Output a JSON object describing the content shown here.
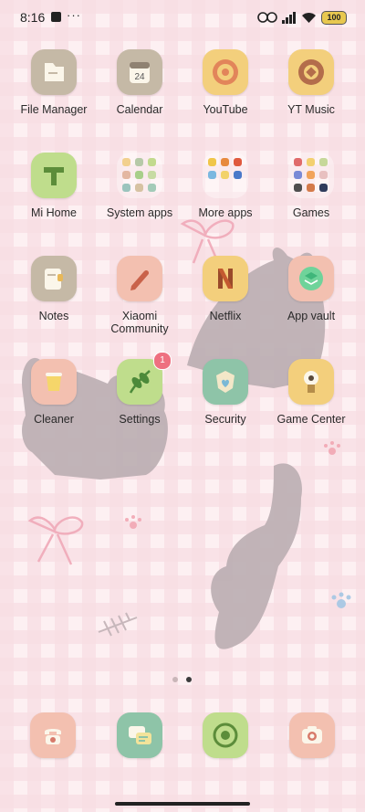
{
  "status": {
    "time": "8:16",
    "dots": "···",
    "battery": "100",
    "icons": [
      "notification-square-icon",
      "vibrate-icon",
      "signal-icon",
      "wifi-icon",
      "battery-icon"
    ]
  },
  "apps": [
    {
      "label": "File Manager",
      "icon": "file-manager-icon"
    },
    {
      "label": "Calendar",
      "icon": "calendar-icon",
      "date_text": "24"
    },
    {
      "label": "YouTube",
      "icon": "youtube-icon"
    },
    {
      "label": "YT Music",
      "icon": "yt-music-icon"
    },
    {
      "label": "Mi Home",
      "icon": "mi-home-icon"
    },
    {
      "label": "System apps",
      "icon": "folder-icon"
    },
    {
      "label": "More apps",
      "icon": "folder-icon"
    },
    {
      "label": "Games",
      "icon": "folder-icon"
    },
    {
      "label": "Notes",
      "icon": "notes-icon"
    },
    {
      "label": "Xiaomi\nCommunity",
      "icon": "xiaomi-community-icon"
    },
    {
      "label": "Netflix",
      "icon": "netflix-icon"
    },
    {
      "label": "App vault",
      "icon": "app-vault-icon"
    },
    {
      "label": "Cleaner",
      "icon": "cleaner-icon"
    },
    {
      "label": "Settings",
      "icon": "settings-icon",
      "badge": "1"
    },
    {
      "label": "Security",
      "icon": "security-icon"
    },
    {
      "label": "Game Center",
      "icon": "game-center-icon"
    }
  ],
  "dock": [
    {
      "icon": "phone-icon"
    },
    {
      "icon": "messages-icon"
    },
    {
      "icon": "browser-icon"
    },
    {
      "icon": "camera-icon"
    }
  ],
  "page_indicator": {
    "pages": 2,
    "current": 2
  },
  "colors": {
    "gingham_pink": "#f6d6dc",
    "cat_gray": "#bcafb3"
  }
}
